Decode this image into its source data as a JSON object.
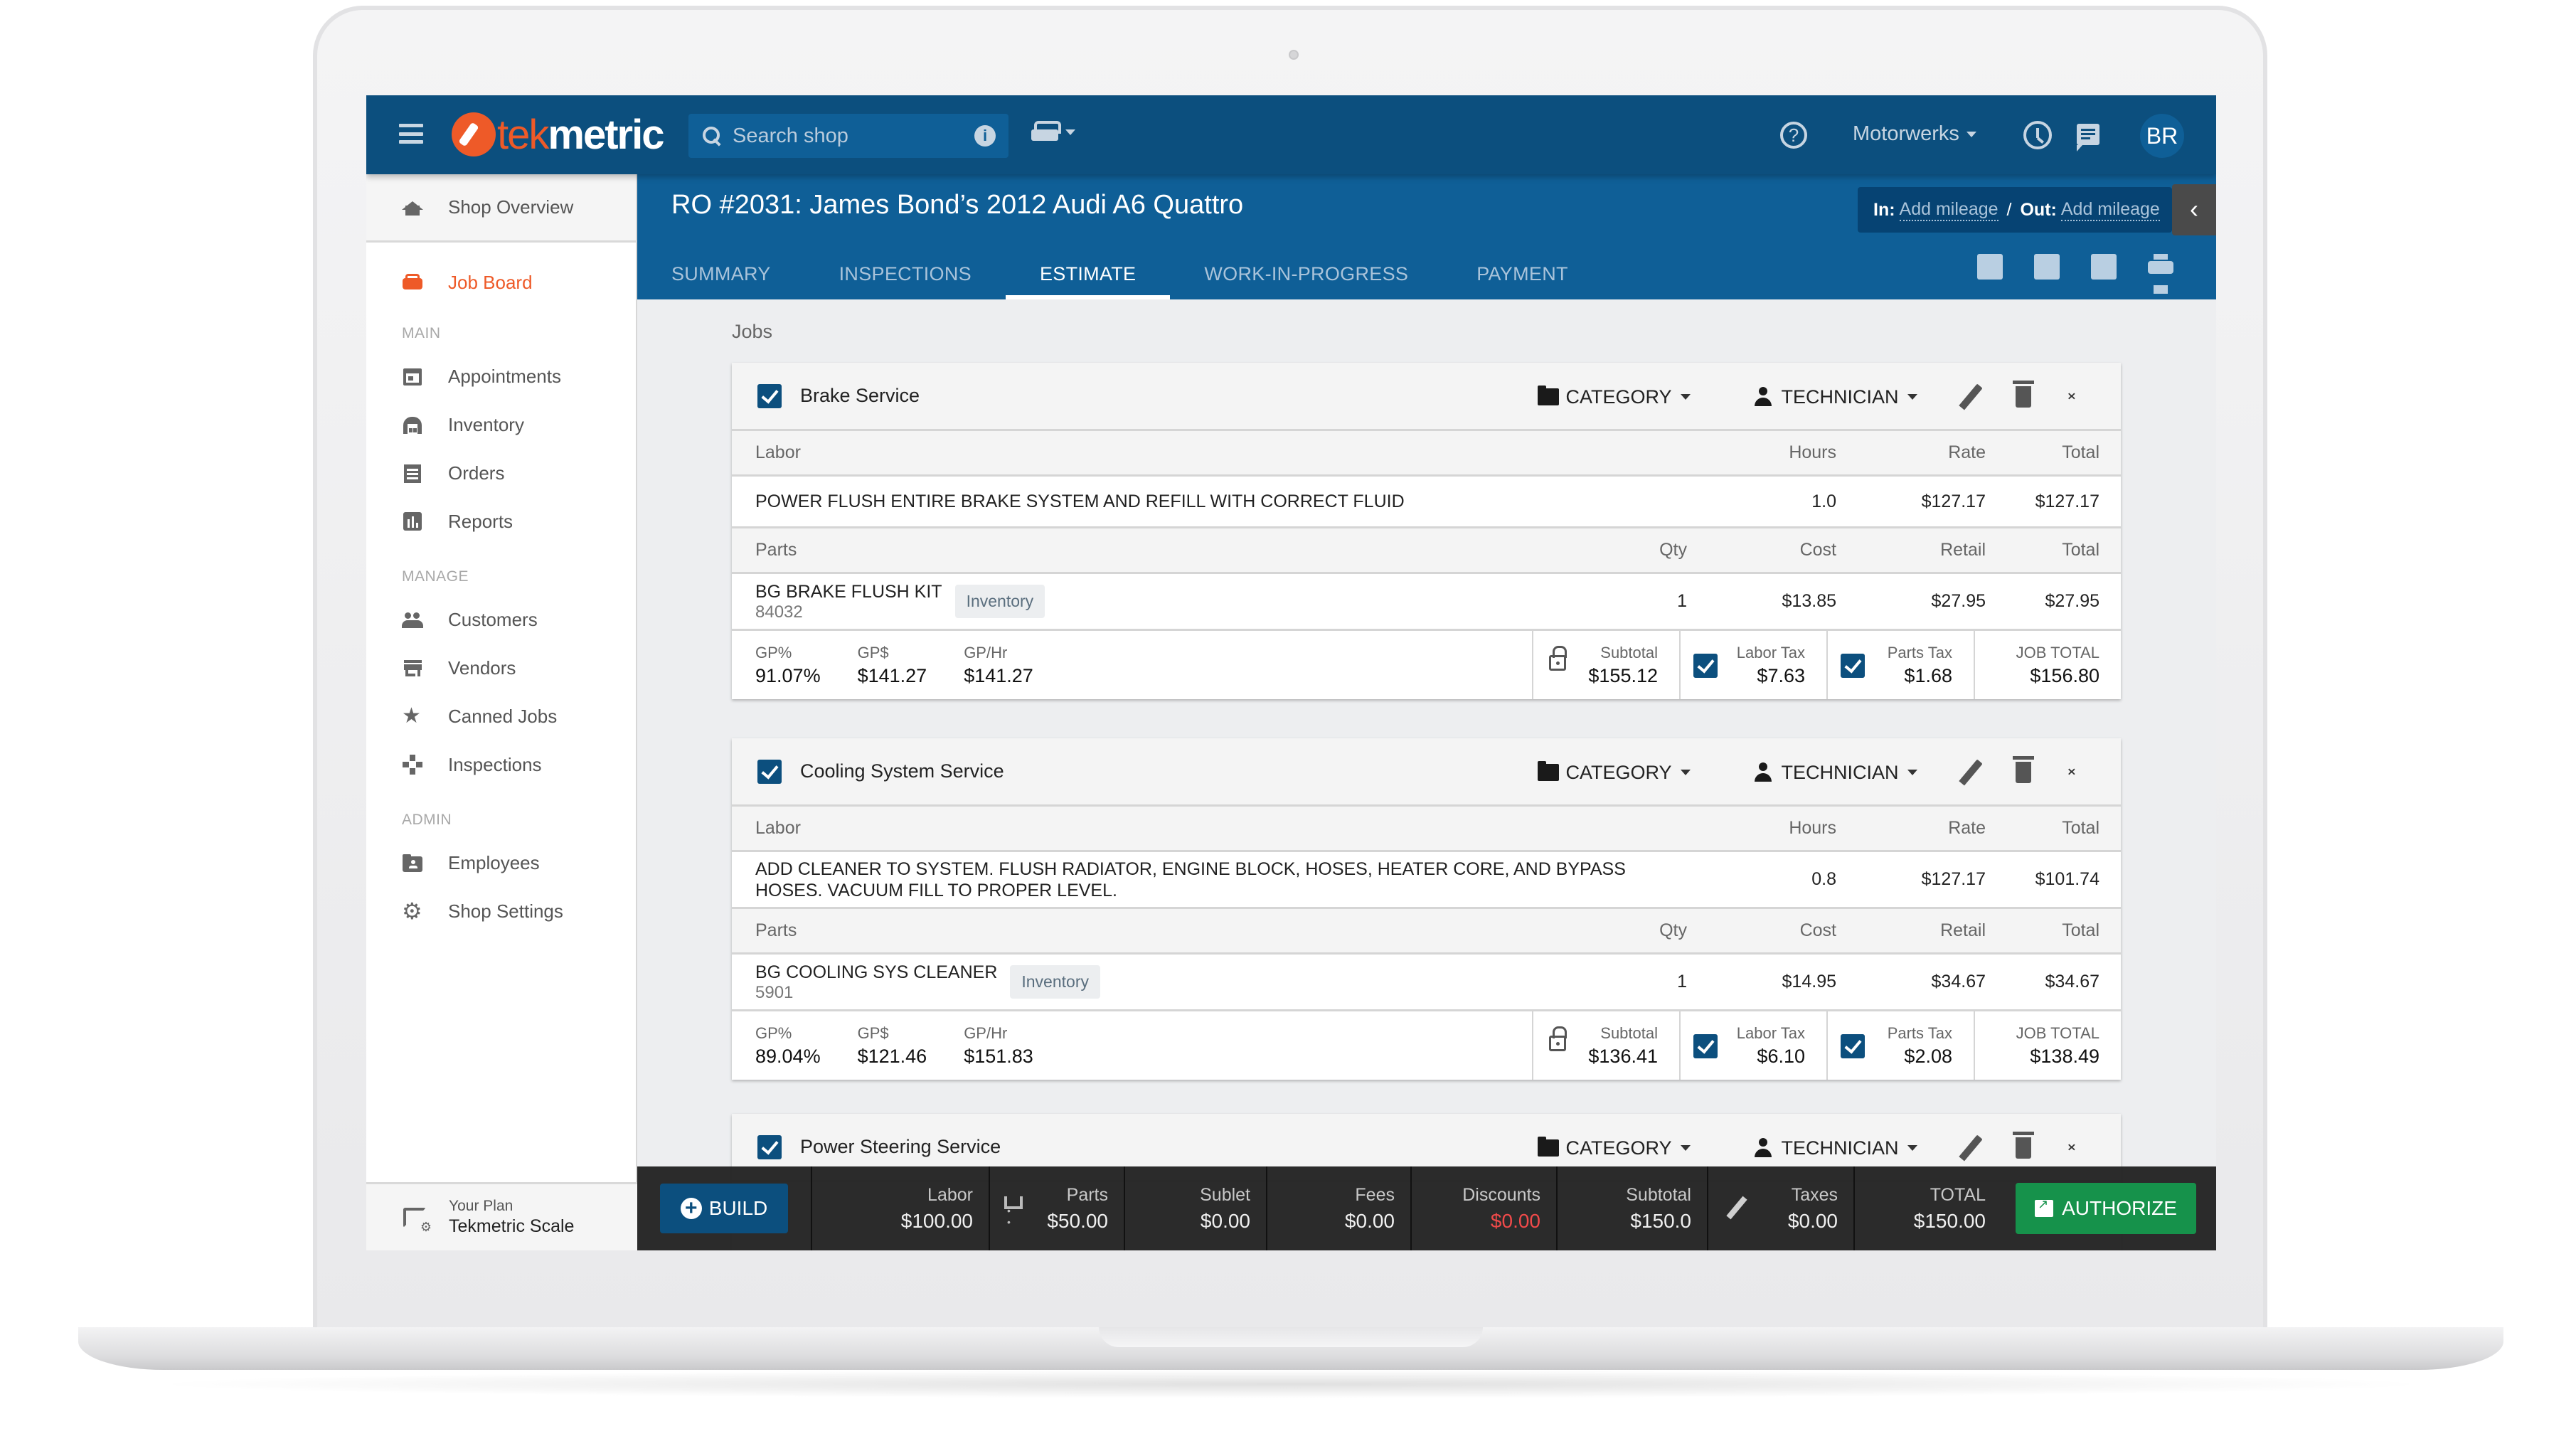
{
  "app": {
    "brand_part1": "tek",
    "brand_part2": "metric",
    "accent_color": "#ee5a28",
    "primary_color": "#0c4f7e"
  },
  "topbar": {
    "search_placeholder": "Search shop",
    "shop_name": "Motorwerks",
    "avatar_initials": "BR",
    "help_glyph": "?"
  },
  "sidebar": {
    "shop_overview": "Shop Overview",
    "job_board": "Job Board",
    "sections": {
      "main": "MAIN",
      "manage": "MANAGE",
      "admin": "ADMIN"
    },
    "main_items": [
      "Appointments",
      "Inventory",
      "Orders",
      "Reports"
    ],
    "manage_items": [
      "Customers",
      "Vendors",
      "Canned Jobs",
      "Inspections"
    ],
    "admin_items": [
      "Employees",
      "Shop Settings"
    ],
    "plan_label": "Your Plan",
    "plan_name": "Tekmetric Scale"
  },
  "ro": {
    "title": "RO #2031: James Bond’s 2012 Audi A6 Quattro",
    "tabs": [
      "SUMMARY",
      "INSPECTIONS",
      "ESTIMATE",
      "WORK-IN-PROGRESS",
      "PAYMENT"
    ],
    "active_tab": "ESTIMATE",
    "mileage_in_label": "In:",
    "mileage_in_value": "Add mileage",
    "mileage_separator": "/",
    "mileage_out_label": "Out:",
    "mileage_out_value": "Add mileage",
    "collapse_glyph": "‹"
  },
  "jobs": {
    "section_label": "Jobs",
    "category_label": "CATEGORY",
    "technician_label": "TECHNICIAN",
    "labor_headers": [
      "Labor",
      "Hours",
      "Rate",
      "Total"
    ],
    "parts_headers": [
      "Parts",
      "Qty",
      "Cost",
      "Retail",
      "Total"
    ],
    "gp_labels": [
      "GP%",
      "GP$",
      "GP/Hr"
    ],
    "total_labels": [
      "Subtotal",
      "Labor Tax",
      "Parts Tax",
      "JOB TOTAL"
    ],
    "inventory_badge": "Inventory",
    "list": [
      {
        "name": "Brake Service",
        "checked": true,
        "labor": {
          "description": "POWER FLUSH ENTIRE BRAKE SYSTEM AND REFILL WITH CORRECT FLUID",
          "hours": "1.0",
          "rate": "$127.17",
          "total": "$127.17"
        },
        "part": {
          "name": "BG BRAKE FLUSH KIT",
          "number": "84032",
          "qty": "1",
          "cost": "$13.85",
          "retail": "$27.95",
          "total": "$27.95"
        },
        "gp_percent": "91.07%",
        "gp_dollars": "$141.27",
        "gp_per_hour": "$141.27",
        "subtotal": "$155.12",
        "labor_tax": "$7.63",
        "parts_tax": "$1.68",
        "job_total": "$156.80"
      },
      {
        "name": "Cooling System Service",
        "checked": true,
        "labor": {
          "description": "ADD CLEANER TO SYSTEM. FLUSH RADIATOR, ENGINE BLOCK, HOSES, HEATER CORE, AND BYPASS HOSES. VACUUM FILL TO PROPER LEVEL.",
          "hours": "0.8",
          "rate": "$127.17",
          "total": "$101.74"
        },
        "part": {
          "name": "BG COOLING SYS CLEANER",
          "number": "5901",
          "qty": "1",
          "cost": "$14.95",
          "retail": "$34.67",
          "total": "$34.67"
        },
        "gp_percent": "89.04%",
        "gp_dollars": "$121.46",
        "gp_per_hour": "$151.83",
        "subtotal": "$136.41",
        "labor_tax": "$6.10",
        "parts_tax": "$2.08",
        "job_total": "$138.49"
      },
      {
        "name": "Power Steering Service",
        "checked": true
      }
    ]
  },
  "summary_bar": {
    "build_label": "BUILD",
    "labor_label": "Labor",
    "labor_value": "$100.00",
    "parts_label": "Parts",
    "parts_value": "$50.00",
    "sublet_label": "Sublet",
    "sublet_value": "$0.00",
    "fees_label": "Fees",
    "fees_value": "$0.00",
    "discounts_label": "Discounts",
    "discounts_value": "$0.00",
    "subtotal_label": "Subtotal",
    "subtotal_value": "$150.0",
    "taxes_label": "Taxes",
    "taxes_value": "$0.00",
    "total_label": "TOTAL",
    "total_value": "$150.00",
    "authorize_label": "AUTHORIZE",
    "discount_color": "#f04a4a",
    "authorize_color": "#16924b"
  }
}
